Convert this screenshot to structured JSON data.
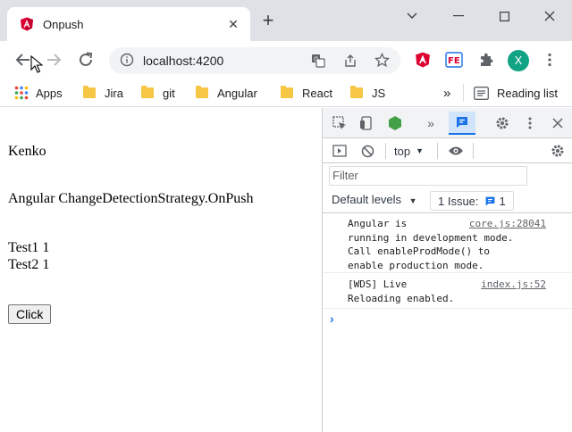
{
  "browser": {
    "tab_title": "Onpush",
    "url": "localhost:4200",
    "profile_initial": "X",
    "bookmarks": [
      "Apps",
      "Jira",
      "git",
      "Angular",
      "React",
      "JS"
    ],
    "bookmarks_more": "»",
    "reading_list": "Reading list"
  },
  "page": {
    "heading": "Kenko",
    "subtitle": "Angular ChangeDetectionStrategy.OnPush",
    "lines": [
      "Test1 1",
      "Test2 1"
    ],
    "button_label": "Click"
  },
  "devtools": {
    "more_tabs": "»",
    "context": "top",
    "filter_placeholder": "Filter",
    "levels": "Default levels",
    "issues_label": "1 Issue:",
    "issues_count": "1",
    "logs": [
      {
        "message": "Angular is\nrunning in development mode.\nCall enableProdMode() to\nenable production mode.",
        "source": "core.js:28041"
      },
      {
        "message": "[WDS] Live\nReloading enabled.",
        "source": "index.js:52"
      }
    ],
    "prompt": "›"
  },
  "colors": {
    "angular_red": "#dd0031",
    "devtools_blue": "#1a73e8",
    "avatar_green": "#12a384",
    "node_green": "#43a047"
  }
}
